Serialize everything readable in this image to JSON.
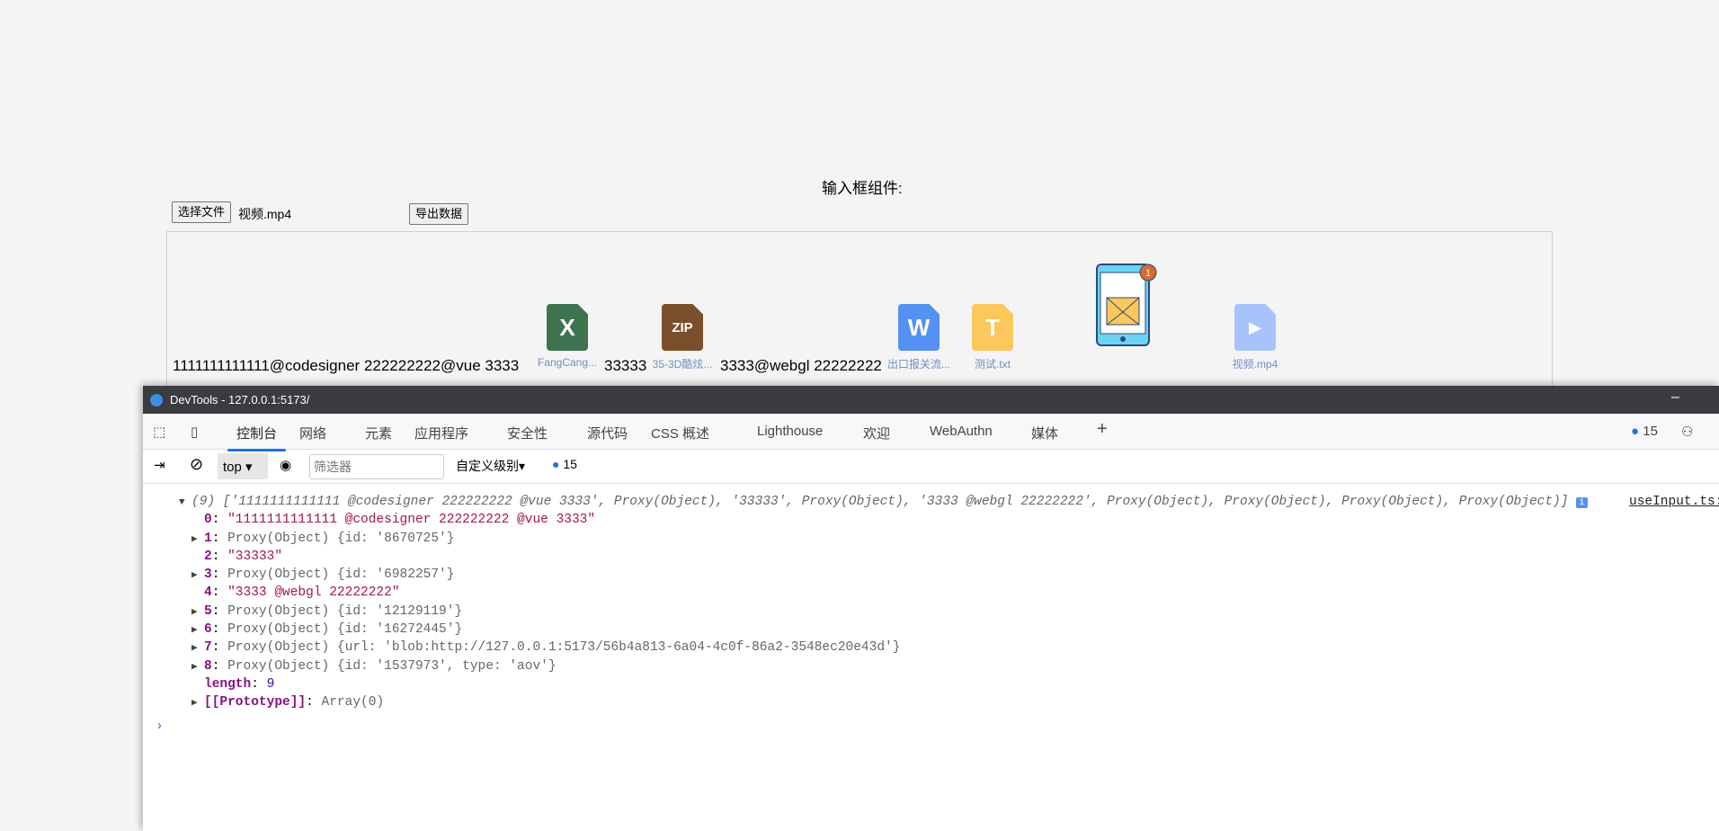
{
  "page": {
    "title": "输入框组件:",
    "choose_file": "选择文件",
    "file_name": "视频.mp4",
    "export": "导出数据"
  },
  "editor": {
    "text1": "1111111111111@codesigner 222222222@vue 3333",
    "file1": {
      "label": "FangCang...",
      "icon": "excel-icon",
      "color": "#3f7350",
      "glyph": "X"
    },
    "text2": "33333",
    "file2": {
      "label": "35-3D酷炫...",
      "icon": "zip-icon",
      "color": "#7a4f2a",
      "glyph": "ZIP"
    },
    "text3": "3333@webgl 22222222",
    "file3": {
      "label": "出口报关流...",
      "icon": "word-icon",
      "color": "#5591f0",
      "glyph": "W"
    },
    "file4": {
      "label": "测试.txt",
      "icon": "txt-icon",
      "color": "#fcc75c",
      "glyph": "T"
    },
    "image_badge": "1",
    "file5": {
      "label": "视频.mp4",
      "icon": "video-icon",
      "color": "#a8c3fb"
    }
  },
  "devtools": {
    "window_title": "DevTools - 127.0.0.1:5173/",
    "tabs": [
      "控制台",
      "网络",
      "元素",
      "应用程序",
      "安全性",
      "源代码",
      "CSS 概述",
      "Lighthouse",
      "欢迎",
      "WebAuthn",
      "媒体"
    ],
    "issues_count": "15",
    "context": "top",
    "filter_placeholder": "筛选器",
    "levels": "自定义级别",
    "msg_count": "15",
    "source_link": "useInput.ts:",
    "summary": "(9) ['1111111111111 @codesigner 222222222 @vue 3333', Proxy(Object), '33333', Proxy(Object), '3333 @webgl 22222222', Proxy(Object), Proxy(Object), Proxy(Object), Proxy(Object)]",
    "entries": [
      {
        "key": "0",
        "value": "\"1111111111111 @codesigner 222222222 @vue 3333\""
      },
      {
        "key": "1",
        "value": "Proxy(Object) {id: '8670725'}"
      },
      {
        "key": "2",
        "value": "\"33333\""
      },
      {
        "key": "3",
        "value": "Proxy(Object) {id: '6982257'}"
      },
      {
        "key": "4",
        "value": "\"3333 @webgl 22222222\""
      },
      {
        "key": "5",
        "value": "Proxy(Object) {id: '12129119'}"
      },
      {
        "key": "6",
        "value": "Proxy(Object) {id: '16272445'}"
      },
      {
        "key": "7",
        "value": "Proxy(Object) {url: 'blob:http://127.0.0.1:5173/56b4a813-6a04-4c0f-86a2-3548ec20e43d'}"
      },
      {
        "key": "8",
        "value": "Proxy(Object) {id: '1537973', type: 'aov'}"
      },
      {
        "key": "length",
        "value": "9"
      },
      {
        "key": "[[Prototype]]",
        "value": "Array(0)"
      }
    ]
  }
}
